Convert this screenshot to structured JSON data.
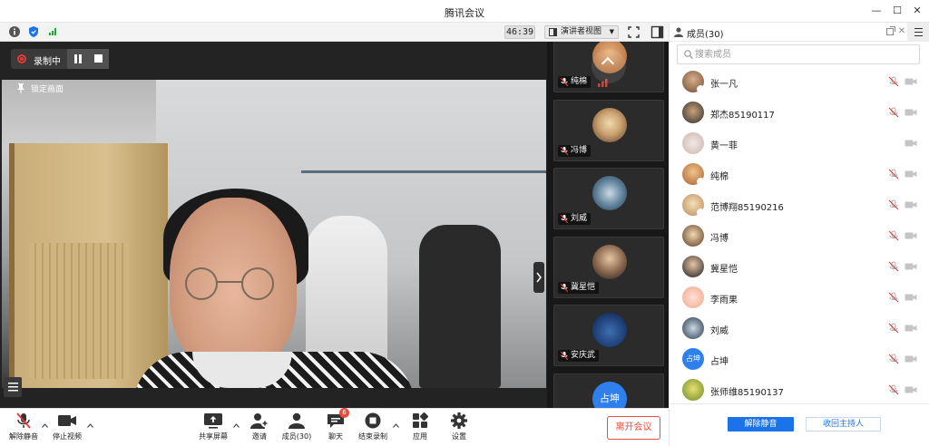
{
  "window": {
    "title": "腾讯会议"
  },
  "status": {
    "timer": "46:39",
    "view_label": "演讲者视图"
  },
  "stage": {
    "recording_label": "录制中",
    "lock_label": "锁定画面"
  },
  "thumbnails": [
    {
      "name": "纯棉"
    },
    {
      "name": "冯博"
    },
    {
      "name": "刘威"
    },
    {
      "name": "冀星恺"
    },
    {
      "name": "安庆武"
    },
    {
      "name": "占坤",
      "avatar_text": "占坤"
    }
  ],
  "panel": {
    "title": "成员(30)",
    "search_placeholder": "搜索成员",
    "members": [
      {
        "name": "张一凡",
        "mic": "muted",
        "cam": "off"
      },
      {
        "name": "郑杰85190117",
        "mic": "muted",
        "cam": "off"
      },
      {
        "name": "黄一菲",
        "mic": "none",
        "cam": "off"
      },
      {
        "name": "纯棉",
        "mic": "muted",
        "cam": "off"
      },
      {
        "name": "范博翔85190216",
        "mic": "muted",
        "cam": "off"
      },
      {
        "name": "冯博",
        "mic": "muted",
        "cam": "off"
      },
      {
        "name": "冀星恺",
        "mic": "muted",
        "cam": "off"
      },
      {
        "name": "李雨果",
        "mic": "muted",
        "cam": "off"
      },
      {
        "name": "刘威",
        "mic": "muted",
        "cam": "off"
      },
      {
        "name": "占坤",
        "mic": "muted",
        "cam": "off",
        "avatar_text": "占坤"
      },
      {
        "name": "张师维85190137",
        "mic": "muted",
        "cam": "off"
      }
    ],
    "unmute_all_label": "解除静音",
    "reclaim_host_label": "收回主持人"
  },
  "toolbar": {
    "unmute_label": "解除静音",
    "stop_video_label": "停止视频",
    "share_screen_label": "共享屏幕",
    "invite_label": "邀请",
    "members_label": "成员(30)",
    "chat_label": "聊天",
    "chat_badge": "6",
    "end_record_label": "结束录制",
    "apps_label": "应用",
    "settings_label": "设置",
    "leave_label": "离开会议"
  },
  "colors": {
    "accent": "#1a73e8",
    "danger": "#e94d3c",
    "record": "#e53935"
  }
}
